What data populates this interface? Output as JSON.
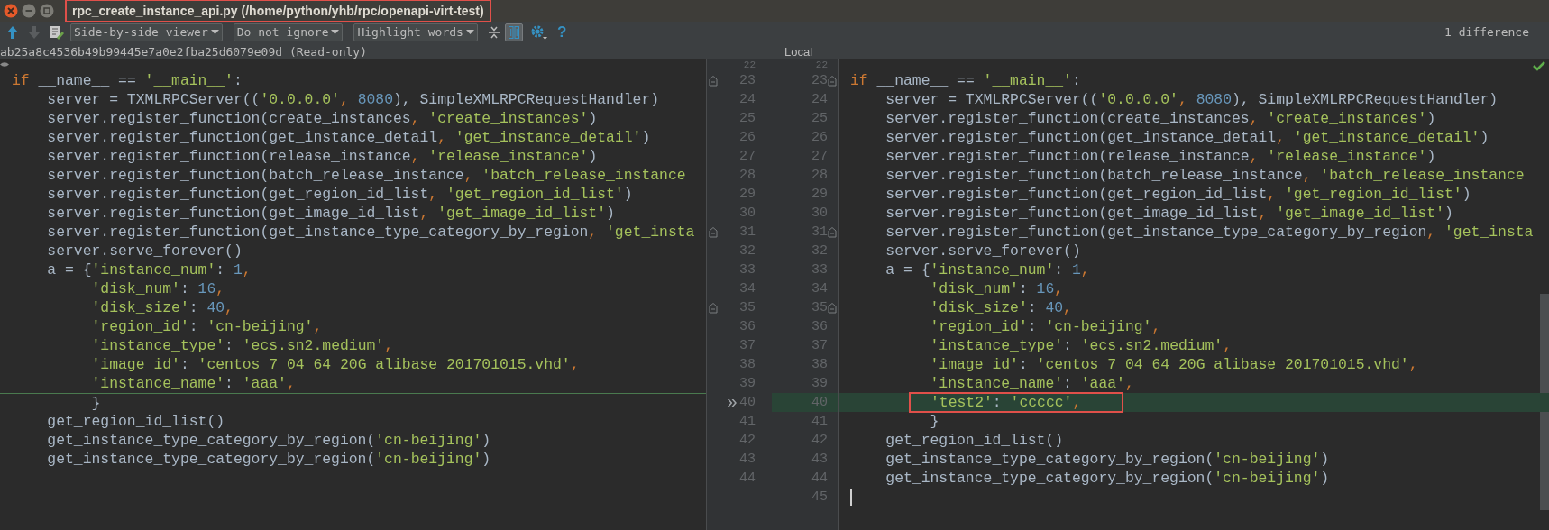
{
  "window": {
    "title": "rpc_create_instance_api.py (/home/python/yhb/rpc/openapi-virt-test)",
    "annotated": true
  },
  "toolbar": {
    "prev_disabled": false,
    "next_disabled": true,
    "dropdowns": [
      {
        "label": "Side-by-side viewer"
      },
      {
        "label": "Do not ignore"
      },
      {
        "label": "Highlight words"
      }
    ],
    "sync_scroll_on": true,
    "help": "?",
    "summary": "1 difference"
  },
  "left_header": "ab25a8c4536b49b99445e7a0e2fba25d6079e09d (Read-only)",
  "right_header": "Local",
  "left": {
    "lines": [
      {
        "number": "22",
        "fold": false
      },
      {
        "number": "23",
        "fold": true,
        "tokens": [
          {
            "kind": "kw",
            "text": "if"
          },
          {
            "kind": "plain",
            "text": " __name__ == "
          },
          {
            "kind": "str",
            "text": "'__main__'"
          },
          {
            "kind": "plain",
            "text": ":"
          }
        ]
      },
      {
        "number": "24",
        "fold": false,
        "tokens": [
          {
            "kind": "plain",
            "text": "    server = TXMLRPCServer(("
          },
          {
            "kind": "str",
            "text": "'0.0.0.0'"
          },
          {
            "kind": "kw",
            "text": ", "
          },
          {
            "kind": "num",
            "text": "8080"
          },
          {
            "kind": "plain",
            "text": "), SimpleXMLRPCRequestHandler)"
          }
        ]
      },
      {
        "number": "25",
        "fold": false,
        "tokens": [
          {
            "kind": "plain",
            "text": "    server.register_function(create_instances"
          },
          {
            "kind": "kw",
            "text": ", "
          },
          {
            "kind": "str",
            "text": "'create_instances'"
          },
          {
            "kind": "plain",
            "text": ")"
          }
        ]
      },
      {
        "number": "26",
        "fold": false,
        "tokens": [
          {
            "kind": "plain",
            "text": "    server.register_function(get_instance_detail"
          },
          {
            "kind": "kw",
            "text": ", "
          },
          {
            "kind": "str",
            "text": "'get_instance_detail'"
          },
          {
            "kind": "plain",
            "text": ")"
          }
        ]
      },
      {
        "number": "27",
        "fold": false,
        "tokens": [
          {
            "kind": "plain",
            "text": "    server.register_function(release_instance"
          },
          {
            "kind": "kw",
            "text": ", "
          },
          {
            "kind": "str",
            "text": "'release_instance'"
          },
          {
            "kind": "plain",
            "text": ")"
          }
        ]
      },
      {
        "number": "28",
        "fold": false,
        "tokens": [
          {
            "kind": "plain",
            "text": "    server.register_function(batch_release_instance"
          },
          {
            "kind": "kw",
            "text": ", "
          },
          {
            "kind": "str",
            "text": "'batch_release_instance"
          }
        ]
      },
      {
        "number": "29",
        "fold": false,
        "tokens": [
          {
            "kind": "plain",
            "text": "    server.register_function(get_region_id_list"
          },
          {
            "kind": "kw",
            "text": ", "
          },
          {
            "kind": "str",
            "text": "'get_region_id_list'"
          },
          {
            "kind": "plain",
            "text": ")"
          }
        ]
      },
      {
        "number": "30",
        "fold": false,
        "tokens": [
          {
            "kind": "plain",
            "text": "    server.register_function(get_image_id_list"
          },
          {
            "kind": "kw",
            "text": ", "
          },
          {
            "kind": "str",
            "text": "'get_image_id_list'"
          },
          {
            "kind": "plain",
            "text": ")"
          }
        ]
      },
      {
        "number": "31",
        "fold": true,
        "tokens": [
          {
            "kind": "plain",
            "text": "    server.register_function(get_instance_type_category_by_region"
          },
          {
            "kind": "kw",
            "text": ", "
          },
          {
            "kind": "str",
            "text": "'get_insta"
          }
        ]
      },
      {
        "number": "32",
        "fold": false,
        "tokens": [
          {
            "kind": "plain",
            "text": "    server.serve_forever()"
          }
        ]
      },
      {
        "number": "33",
        "fold": false,
        "tokens": [
          {
            "kind": "plain",
            "text": "    a = {"
          },
          {
            "kind": "str",
            "text": "'instance_num'"
          },
          {
            "kind": "plain",
            "text": ": "
          },
          {
            "kind": "num",
            "text": "1"
          },
          {
            "kind": "kw",
            "text": ","
          }
        ]
      },
      {
        "number": "34",
        "fold": false,
        "tokens": [
          {
            "kind": "str",
            "text": "         'disk_num'"
          },
          {
            "kind": "plain",
            "text": ": "
          },
          {
            "kind": "num",
            "text": "16"
          },
          {
            "kind": "kw",
            "text": ","
          }
        ]
      },
      {
        "number": "35",
        "fold": true,
        "tokens": [
          {
            "kind": "str",
            "text": "         'disk_size'"
          },
          {
            "kind": "plain",
            "text": ": "
          },
          {
            "kind": "num",
            "text": "40"
          },
          {
            "kind": "kw",
            "text": ","
          }
        ]
      },
      {
        "number": "36",
        "fold": false,
        "tokens": [
          {
            "kind": "str",
            "text": "         'region_id'"
          },
          {
            "kind": "plain",
            "text": ": "
          },
          {
            "kind": "str",
            "text": "'cn-beijing'"
          },
          {
            "kind": "kw",
            "text": ","
          }
        ]
      },
      {
        "number": "37",
        "fold": false,
        "tokens": [
          {
            "kind": "str",
            "text": "         'instance_type'"
          },
          {
            "kind": "plain",
            "text": ": "
          },
          {
            "kind": "str",
            "text": "'ecs.sn2.medium'"
          },
          {
            "kind": "kw",
            "text": ","
          }
        ]
      },
      {
        "number": "38",
        "fold": false,
        "tokens": [
          {
            "kind": "str",
            "text": "         'image_id'"
          },
          {
            "kind": "plain",
            "text": ": "
          },
          {
            "kind": "str",
            "text": "'centos_7_04_64_20G_alibase_201701015.vhd'"
          },
          {
            "kind": "kw",
            "text": ","
          }
        ]
      },
      {
        "number": "39",
        "fold": false,
        "tokens": [
          {
            "kind": "str",
            "text": "         'instance_name'"
          },
          {
            "kind": "plain",
            "text": ": "
          },
          {
            "kind": "str",
            "text": "'aaa'"
          },
          {
            "kind": "kw",
            "text": ","
          }
        ]
      },
      {
        "number": "40",
        "fold": false,
        "insertion_before": true,
        "marker": "»",
        "tokens": [
          {
            "kind": "plain",
            "text": "         }"
          }
        ]
      },
      {
        "number": "41",
        "fold": false,
        "tokens": [
          {
            "kind": "plain",
            "text": "    get_region_id_list()"
          }
        ]
      },
      {
        "number": "42",
        "fold": false,
        "tokens": [
          {
            "kind": "plain",
            "text": "    get_instance_type_category_by_region("
          },
          {
            "kind": "str",
            "text": "'cn-beijing'"
          },
          {
            "kind": "plain",
            "text": ")"
          }
        ]
      },
      {
        "number": "43",
        "fold": false,
        "tokens": [
          {
            "kind": "plain",
            "text": "    get_instance_type_category_by_region("
          },
          {
            "kind": "str",
            "text": "'cn-beijing'"
          },
          {
            "kind": "plain",
            "text": ")"
          }
        ]
      },
      {
        "number": "44",
        "fold": false
      }
    ]
  },
  "right": {
    "lines": [
      {
        "number": "22",
        "fold": false
      },
      {
        "number": "23",
        "fold": true,
        "tokens": [
          {
            "kind": "kw",
            "text": "if"
          },
          {
            "kind": "plain",
            "text": " __name__ == "
          },
          {
            "kind": "str",
            "text": "'__main__'"
          },
          {
            "kind": "plain",
            "text": ":"
          }
        ]
      },
      {
        "number": "24",
        "fold": false,
        "tokens": [
          {
            "kind": "plain",
            "text": "    server = TXMLRPCServer(("
          },
          {
            "kind": "str",
            "text": "'0.0.0.0'"
          },
          {
            "kind": "kw",
            "text": ", "
          },
          {
            "kind": "num",
            "text": "8080"
          },
          {
            "kind": "plain",
            "text": "), SimpleXMLRPCRequestHandler)"
          }
        ]
      },
      {
        "number": "25",
        "fold": false,
        "tokens": [
          {
            "kind": "plain",
            "text": "    server.register_function(create_instances"
          },
          {
            "kind": "kw",
            "text": ", "
          },
          {
            "kind": "str",
            "text": "'create_instances'"
          },
          {
            "kind": "plain",
            "text": ")"
          }
        ]
      },
      {
        "number": "26",
        "fold": false,
        "tokens": [
          {
            "kind": "plain",
            "text": "    server.register_function(get_instance_detail"
          },
          {
            "kind": "kw",
            "text": ", "
          },
          {
            "kind": "str",
            "text": "'get_instance_detail'"
          },
          {
            "kind": "plain",
            "text": ")"
          }
        ]
      },
      {
        "number": "27",
        "fold": false,
        "tokens": [
          {
            "kind": "plain",
            "text": "    server.register_function(release_instance"
          },
          {
            "kind": "kw",
            "text": ", "
          },
          {
            "kind": "str",
            "text": "'release_instance'"
          },
          {
            "kind": "plain",
            "text": ")"
          }
        ]
      },
      {
        "number": "28",
        "fold": false,
        "tokens": [
          {
            "kind": "plain",
            "text": "    server.register_function(batch_release_instance"
          },
          {
            "kind": "kw",
            "text": ", "
          },
          {
            "kind": "str",
            "text": "'batch_release_instance"
          }
        ]
      },
      {
        "number": "29",
        "fold": false,
        "tokens": [
          {
            "kind": "plain",
            "text": "    server.register_function(get_region_id_list"
          },
          {
            "kind": "kw",
            "text": ", "
          },
          {
            "kind": "str",
            "text": "'get_region_id_list'"
          },
          {
            "kind": "plain",
            "text": ")"
          }
        ]
      },
      {
        "number": "30",
        "fold": false,
        "tokens": [
          {
            "kind": "plain",
            "text": "    server.register_function(get_image_id_list"
          },
          {
            "kind": "kw",
            "text": ", "
          },
          {
            "kind": "str",
            "text": "'get_image_id_list'"
          },
          {
            "kind": "plain",
            "text": ")"
          }
        ]
      },
      {
        "number": "31",
        "fold": true,
        "tokens": [
          {
            "kind": "plain",
            "text": "    server.register_function(get_instance_type_category_by_region"
          },
          {
            "kind": "kw",
            "text": ", "
          },
          {
            "kind": "str",
            "text": "'get_insta"
          }
        ]
      },
      {
        "number": "32",
        "fold": false,
        "tokens": [
          {
            "kind": "plain",
            "text": "    server.serve_forever()"
          }
        ]
      },
      {
        "number": "33",
        "fold": false,
        "tokens": [
          {
            "kind": "plain",
            "text": "    a = {"
          },
          {
            "kind": "str",
            "text": "'instance_num'"
          },
          {
            "kind": "plain",
            "text": ": "
          },
          {
            "kind": "num",
            "text": "1"
          },
          {
            "kind": "kw",
            "text": ","
          }
        ]
      },
      {
        "number": "34",
        "fold": false,
        "tokens": [
          {
            "kind": "str",
            "text": "         'disk_num'"
          },
          {
            "kind": "plain",
            "text": ": "
          },
          {
            "kind": "num",
            "text": "16"
          },
          {
            "kind": "kw",
            "text": ","
          }
        ]
      },
      {
        "number": "35",
        "fold": true,
        "tokens": [
          {
            "kind": "str",
            "text": "         'disk_size'"
          },
          {
            "kind": "plain",
            "text": ": "
          },
          {
            "kind": "num",
            "text": "40"
          },
          {
            "kind": "kw",
            "text": ","
          }
        ]
      },
      {
        "number": "36",
        "fold": false,
        "tokens": [
          {
            "kind": "str",
            "text": "         'region_id'"
          },
          {
            "kind": "plain",
            "text": ": "
          },
          {
            "kind": "str",
            "text": "'cn-beijing'"
          },
          {
            "kind": "kw",
            "text": ","
          }
        ]
      },
      {
        "number": "37",
        "fold": false,
        "tokens": [
          {
            "kind": "str",
            "text": "         'instance_type'"
          },
          {
            "kind": "plain",
            "text": ": "
          },
          {
            "kind": "str",
            "text": "'ecs.sn2.medium'"
          },
          {
            "kind": "kw",
            "text": ","
          }
        ]
      },
      {
        "number": "38",
        "fold": false,
        "tokens": [
          {
            "kind": "str",
            "text": "         'image_id'"
          },
          {
            "kind": "plain",
            "text": ": "
          },
          {
            "kind": "str",
            "text": "'centos_7_04_64_20G_alibase_201701015.vhd'"
          },
          {
            "kind": "kw",
            "text": ","
          }
        ]
      },
      {
        "number": "39",
        "fold": false,
        "tokens": [
          {
            "kind": "str",
            "text": "         'instance_name'"
          },
          {
            "kind": "plain",
            "text": ": "
          },
          {
            "kind": "str",
            "text": "'aaa'"
          },
          {
            "kind": "kw",
            "text": ","
          }
        ]
      },
      {
        "number": "40",
        "fold": false,
        "changed": true,
        "annotated": true,
        "tokens": [
          {
            "kind": "str",
            "text": "'test2'"
          },
          {
            "kind": "plain",
            "text": ": "
          },
          {
            "kind": "str",
            "text": "'ccccc'"
          },
          {
            "kind": "kw",
            "text": ","
          }
        ]
      },
      {
        "number": "41",
        "fold": false,
        "tokens": [
          {
            "kind": "plain",
            "text": "         }"
          }
        ]
      },
      {
        "number": "42",
        "fold": false,
        "tokens": [
          {
            "kind": "plain",
            "text": "    get_region_id_list()"
          }
        ]
      },
      {
        "number": "43",
        "fold": false,
        "tokens": [
          {
            "kind": "plain",
            "text": "    get_instance_type_category_by_region("
          },
          {
            "kind": "str",
            "text": "'cn-beijing'"
          },
          {
            "kind": "plain",
            "text": ")"
          }
        ]
      },
      {
        "number": "44",
        "fold": false,
        "tokens": [
          {
            "kind": "plain",
            "text": "    get_instance_type_category_by_region("
          },
          {
            "kind": "str",
            "text": "'cn-beijing'"
          },
          {
            "kind": "plain",
            "text": ")"
          }
        ]
      },
      {
        "number": "45",
        "fold": false,
        "cursor": true
      }
    ]
  }
}
